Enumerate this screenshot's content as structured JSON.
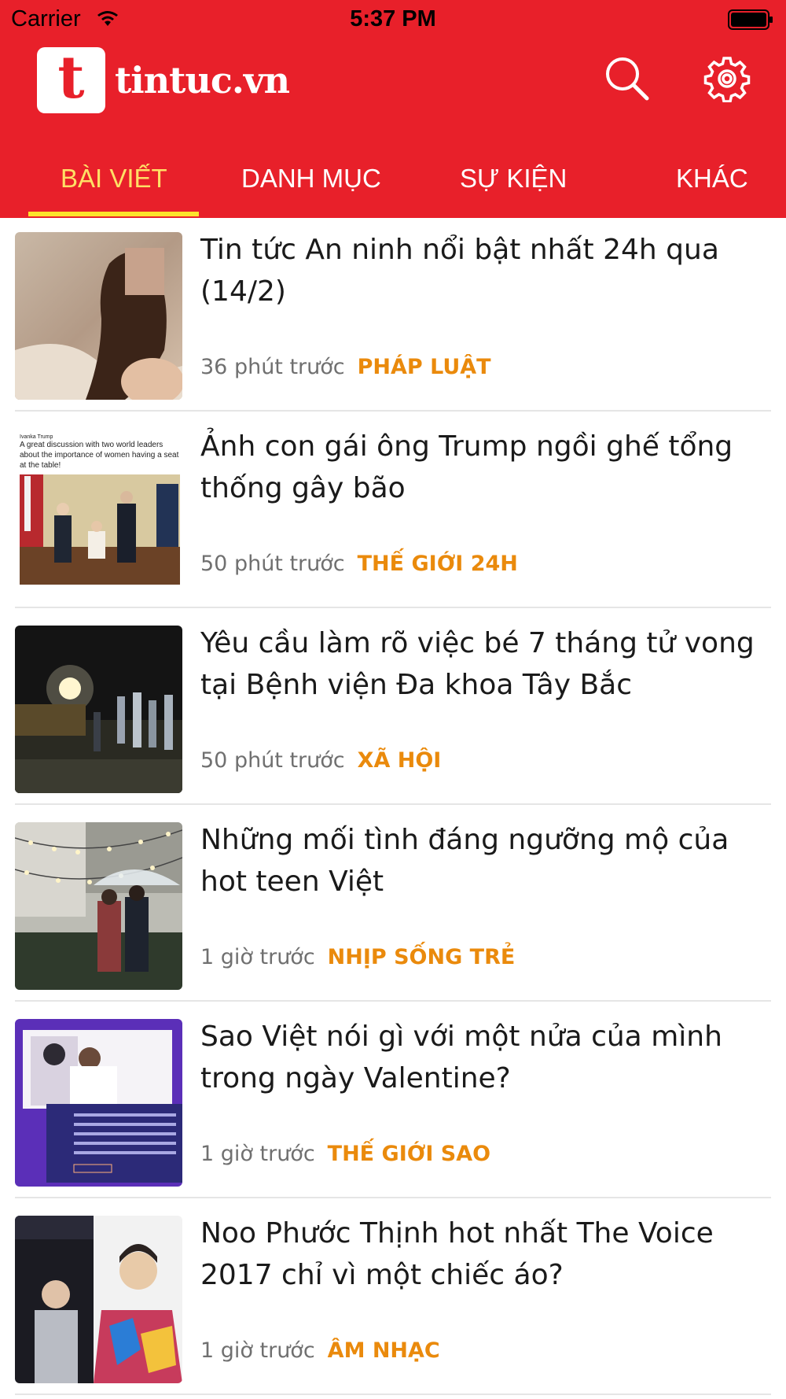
{
  "status_bar": {
    "carrier": "Carrier",
    "time": "5:37 PM"
  },
  "header": {
    "logo_letter": "t",
    "logo_text": "tintuc.vn",
    "bg_color": "#e8202a",
    "search_icon": "search-icon",
    "settings_icon": "gear-icon"
  },
  "tabs": [
    {
      "label": "BÀI VIẾT",
      "active": true
    },
    {
      "label": "DANH MỤC",
      "active": false
    },
    {
      "label": "SỰ KIỆN",
      "active": false
    },
    {
      "label": "KHÁC",
      "active": false
    }
  ],
  "articles": [
    {
      "title": "Tin tức An ninh nổi bật nhất 24h qua (14/2)",
      "time": "36 phút trước",
      "category": "PHÁP LUẬT"
    },
    {
      "title": "Ảnh con gái ông Trump ngồi ghế tổng thống gây bão",
      "time": "50 phút trước",
      "category": "THẾ GIỚI 24H"
    },
    {
      "title": "Yêu cầu làm rõ việc bé 7 tháng tử vong tại Bệnh viện Đa khoa Tây Bắc",
      "time": "50 phút trước",
      "category": "XÃ HỘI"
    },
    {
      "title": "Những mối tình đáng ngưỡng mộ của hot teen Việt",
      "time": "1 giờ trước",
      "category": "NHỊP SỐNG TRẺ"
    },
    {
      "title": "Sao Việt nói gì với một nửa của mình trong ngày Valentine?",
      "time": "1 giờ trước",
      "category": "THẾ GIỚI SAO"
    },
    {
      "title": "Noo Phước Thịnh hot nhất The Voice 2017 chỉ vì một chiếc áo?",
      "time": "1 giờ trước",
      "category": "ÂM NHẠC"
    }
  ],
  "tweet_snippet": {
    "author": "Ivanka Trump",
    "text": "A great discussion with two world leaders about the importance of women having a seat at the table!"
  },
  "colors": {
    "accent": "#e8202a",
    "tab_active": "#ffe066",
    "category": "#ea8a0c"
  }
}
